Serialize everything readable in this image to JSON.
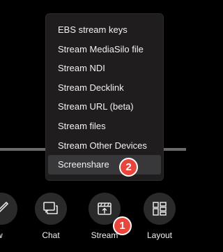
{
  "menu": {
    "items": [
      "EBS stream keys",
      "Stream MediaSilo file",
      "Stream NDI",
      "Stream Decklink",
      "Stream URL (beta)",
      "Stream files",
      "Stream Other Devices",
      "Screenshare"
    ],
    "highlighted": "Screenshare"
  },
  "badges": {
    "step1": "1",
    "step2": "2",
    "color": "#e8453c"
  },
  "toolbar": {
    "partial_label": "w",
    "chat_label": "Chat",
    "stream_label": "Stream",
    "layout_label": "Layout",
    "partial_icon": "pencil-icon",
    "chat_icon": "chat-bubble-icon",
    "stream_icon": "stream-upload-icon",
    "layout_icon": "layout-grid-icon"
  }
}
